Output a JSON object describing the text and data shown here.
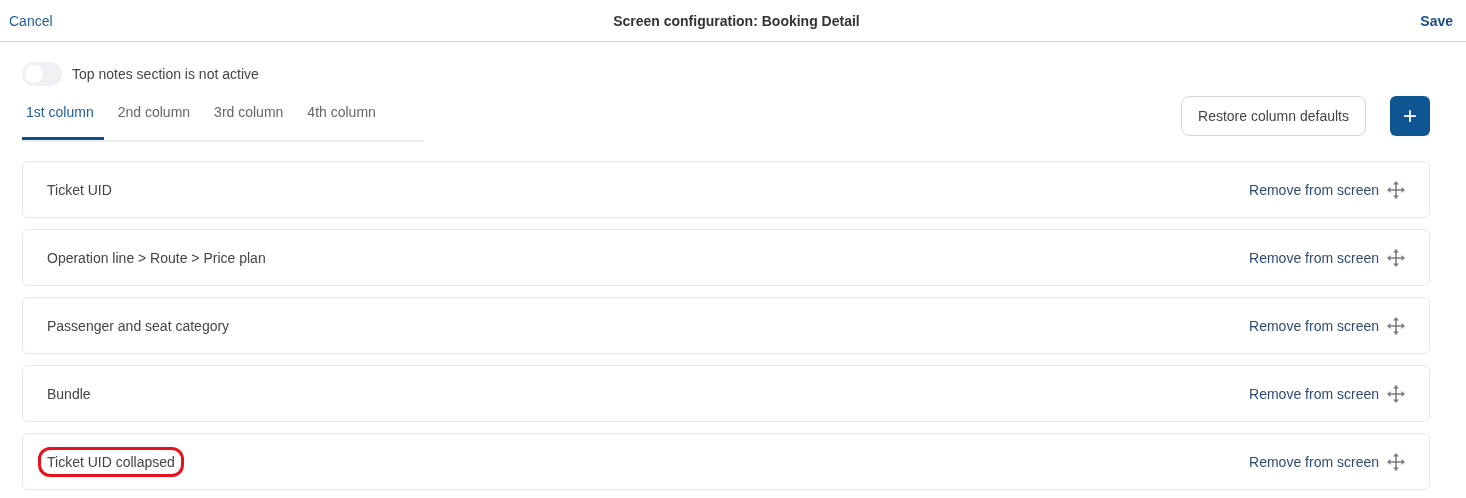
{
  "header": {
    "cancel": "Cancel",
    "title": "Screen configuration: Booking Detail",
    "save": "Save"
  },
  "top_notes": {
    "on": false,
    "label": "Top notes section is not active"
  },
  "tabs": [
    {
      "label": "1st column",
      "selected": true
    },
    {
      "label": "2nd column",
      "selected": false
    },
    {
      "label": "3rd column",
      "selected": false
    },
    {
      "label": "4th column",
      "selected": false
    }
  ],
  "restore_button": "Restore column defaults",
  "add_button": "+",
  "fields": [
    {
      "label": "Ticket UID",
      "action": "Remove from screen",
      "highlighted": false
    },
    {
      "label": "Operation line > Route > Price plan",
      "action": "Remove from screen",
      "highlighted": false
    },
    {
      "label": "Passenger and seat category",
      "action": "Remove from screen",
      "highlighted": false
    },
    {
      "label": "Bundle",
      "action": "Remove from screen",
      "highlighted": false
    },
    {
      "label": "Ticket UID collapsed",
      "action": "Remove from screen",
      "highlighted": true
    }
  ]
}
